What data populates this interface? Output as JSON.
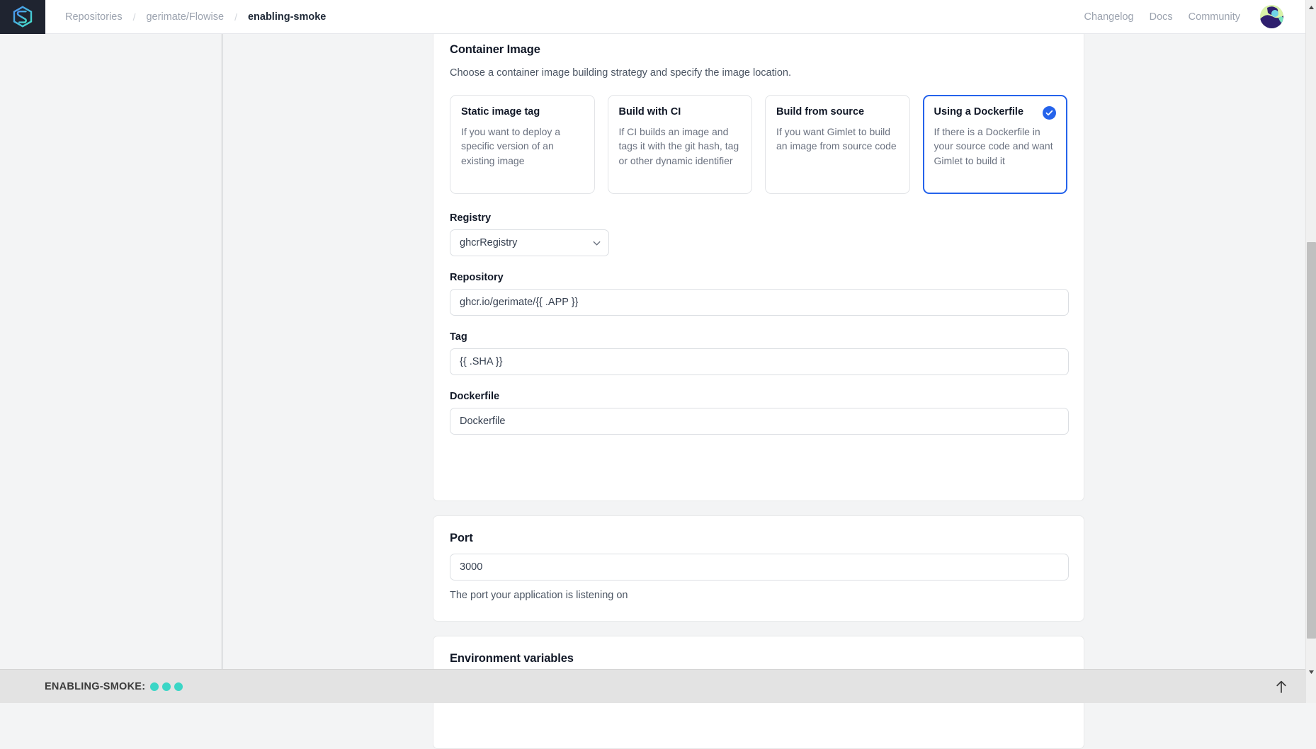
{
  "topbar": {
    "logo_icon": "gimlet-hexagon-logo",
    "breadcrumb": {
      "repositories": "Repositories",
      "separator": "/",
      "org_repo": "gerimate/Flowise",
      "current": "enabling-smoke"
    },
    "nav_links": [
      {
        "label": "Changelog"
      },
      {
        "label": "Docs"
      },
      {
        "label": "Community"
      }
    ],
    "avatar_alt": "user-avatar"
  },
  "container_image": {
    "title": "Container Image",
    "subtitle": "Choose a container image building strategy and specify the image location.",
    "strategies": [
      {
        "name": "Static image tag",
        "description": "If you want to deploy a specific version of an existing image",
        "selected": false
      },
      {
        "name": "Build with CI",
        "description": "If CI builds an image and tags it with the git hash, tag or other dynamic identifier",
        "selected": false
      },
      {
        "name": "Build from source",
        "description": "If you want Gimlet to build an image from source code",
        "selected": false
      },
      {
        "name": "Using a Dockerfile",
        "description": "If there is a Dockerfile in your source code and want Gimlet to build it",
        "selected": true
      }
    ],
    "registry": {
      "label": "Registry",
      "value": "ghcrRegistry",
      "options": [
        "ghcrRegistry"
      ],
      "chevron_icon": "chevron-down-icon"
    },
    "repository": {
      "label": "Repository",
      "value": "ghcr.io/gerimate/{{ .APP }}",
      "placeholder": ""
    },
    "tag": {
      "label": "Tag",
      "value": "{{ .SHA }}",
      "placeholder": ""
    },
    "dockerfile": {
      "label": "Dockerfile",
      "value": "Dockerfile",
      "placeholder": ""
    }
  },
  "port": {
    "title": "Port",
    "value": "3000",
    "placeholder": "",
    "helper": "The port your application is listening on"
  },
  "environment": {
    "title": "Environment variables",
    "add_label": "+"
  },
  "bottombar": {
    "app_label": "ENABLING-SMOKE:",
    "status_dots": 3,
    "dot_color": "#3bd6c6",
    "scroll_top_icon": "arrow-up-icon"
  },
  "colors": {
    "accent": "#2563eb",
    "button_blue": "#3b82f6",
    "page_bg": "#f3f4f5",
    "card_bg": "#ffffff",
    "bottom_bar_bg": "#e3e3e3"
  }
}
